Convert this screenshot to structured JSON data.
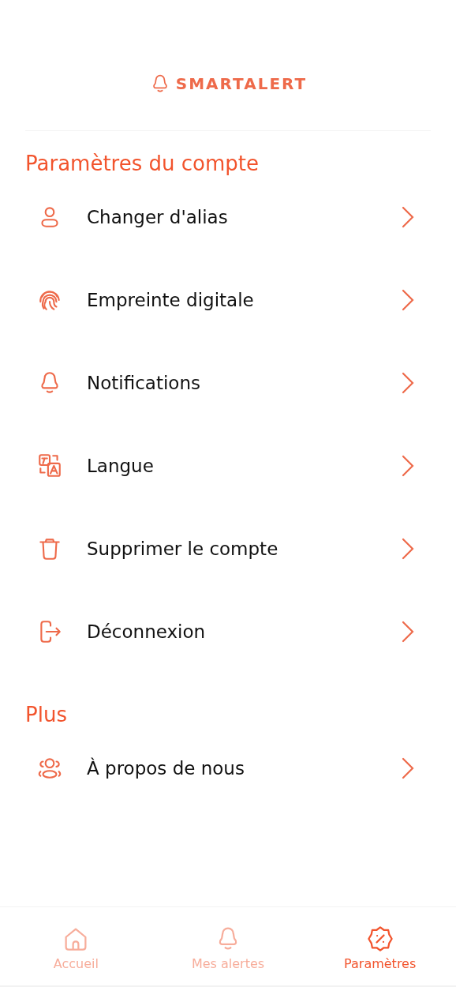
{
  "header": {
    "logo_text": "SMARTALERT"
  },
  "sections": [
    {
      "title": "Paramètres du compte",
      "items": [
        {
          "label": "Changer d'alias"
        },
        {
          "label": "Empreinte digitale"
        },
        {
          "label": "Notifications"
        },
        {
          "label": "Langue"
        },
        {
          "label": "Supprimer le compte"
        },
        {
          "label": "Déconnexion"
        }
      ]
    },
    {
      "title": "Plus",
      "items": [
        {
          "label": "À propos de nous"
        }
      ]
    }
  ],
  "nav": [
    {
      "label": "Accueil",
      "selected": false
    },
    {
      "label": "Mes alertes",
      "selected": false
    },
    {
      "label": "Paramètres",
      "selected": true
    }
  ]
}
